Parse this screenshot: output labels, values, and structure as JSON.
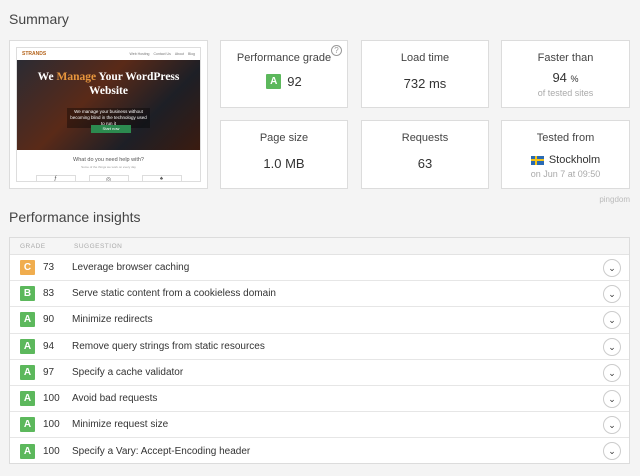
{
  "summary": {
    "title": "Summary"
  },
  "screenshot": {
    "logo": "STRANDS",
    "nav": [
      "Web Hosting",
      "Contact Us",
      "About",
      "Blog"
    ],
    "headline_a": "We ",
    "headline_em": "Manage",
    "headline_b": " Your WordPress",
    "headline_c": "Website",
    "subtext": "We manage your business without becoming blind in the technology used to run it",
    "button": "Start now",
    "question": "What do you need help with?",
    "question_sub": "Some of the things we work on every day",
    "icons": [
      "ƒ",
      "◎",
      "♠"
    ]
  },
  "metrics": {
    "perf_grade": {
      "label": "Performance grade",
      "grade": "A",
      "value": "92",
      "help": "?"
    },
    "load_time": {
      "label": "Load time",
      "value": "732 ms"
    },
    "faster_than": {
      "label": "Faster than",
      "value": "94",
      "unit": "%",
      "sub": "of tested sites"
    },
    "page_size": {
      "label": "Page size",
      "value": "1.0 MB"
    },
    "requests": {
      "label": "Requests",
      "value": "63"
    },
    "tested_from": {
      "label": "Tested from",
      "location": "Stockholm",
      "sub": "on Jun 7 at 09:50"
    }
  },
  "stamp": "pingdom",
  "insights": {
    "title": "Performance insights",
    "headers": {
      "grade": "GRADE",
      "suggestion": "SUGGESTION"
    },
    "rows": [
      {
        "grade": "C",
        "score": "73",
        "suggestion": "Leverage browser caching"
      },
      {
        "grade": "B",
        "score": "83",
        "suggestion": "Serve static content from a cookieless domain"
      },
      {
        "grade": "A",
        "score": "90",
        "suggestion": "Minimize redirects"
      },
      {
        "grade": "A",
        "score": "94",
        "suggestion": "Remove query strings from static resources"
      },
      {
        "grade": "A",
        "score": "97",
        "suggestion": "Specify a cache validator"
      },
      {
        "grade": "A",
        "score": "100",
        "suggestion": "Avoid bad requests"
      },
      {
        "grade": "A",
        "score": "100",
        "suggestion": "Minimize request size"
      },
      {
        "grade": "A",
        "score": "100",
        "suggestion": "Specify a Vary: Accept-Encoding header"
      }
    ]
  },
  "colors": {
    "grade_a": "#5cb85c",
    "grade_b": "#5cb85c",
    "grade_c": "#f0ad4e"
  }
}
